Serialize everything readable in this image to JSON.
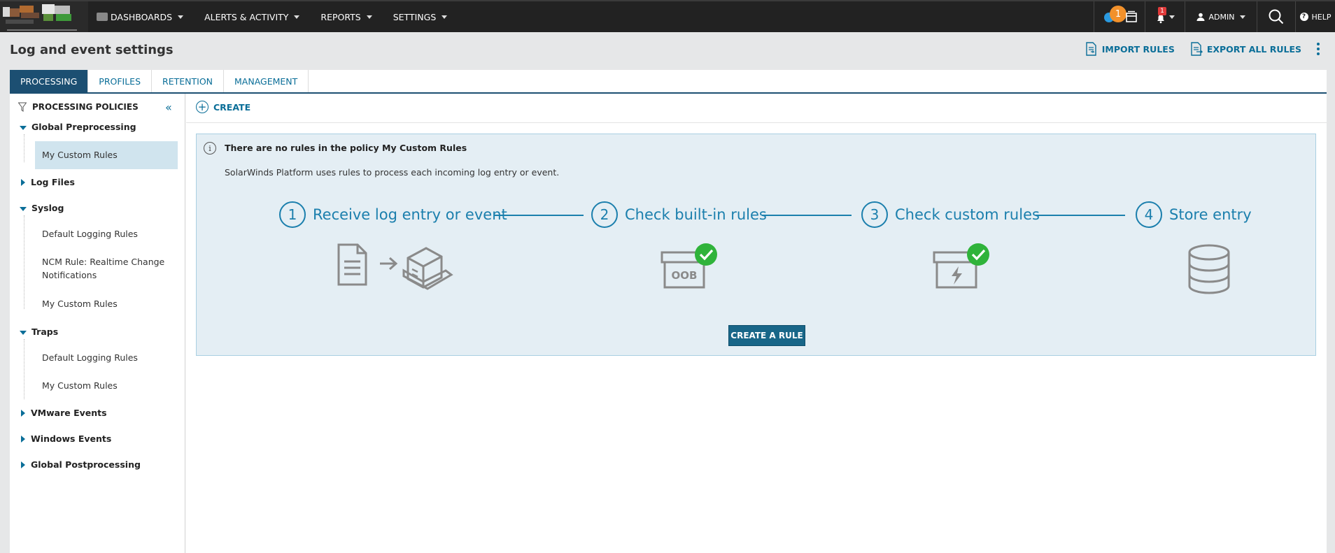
{
  "nav": {
    "items": [
      {
        "label": "DASHBOARDS"
      },
      {
        "label": "ALERTS & ACTIVITY"
      },
      {
        "label": "REPORTS"
      },
      {
        "label": "SETTINGS"
      }
    ],
    "notification_count": "1",
    "alert_count": "1",
    "user_label": "ADMIN",
    "help_label": "HELP",
    "help_glyph": "?"
  },
  "page": {
    "title": "Log and event settings",
    "import_label": "IMPORT RULES",
    "export_label": "EXPORT ALL RULES"
  },
  "tabs": [
    {
      "label": "PROCESSING",
      "active": true
    },
    {
      "label": "PROFILES"
    },
    {
      "label": "RETENTION"
    },
    {
      "label": "MANAGEMENT"
    }
  ],
  "sidebar": {
    "title": "PROCESSING POLICIES",
    "collapse_glyph": "«",
    "groups": [
      {
        "label": "Global Preprocessing",
        "expanded": true,
        "children": [
          "My Custom Rules"
        ]
      },
      {
        "label": "Log Files",
        "expanded": false
      },
      {
        "label": "Syslog",
        "expanded": true,
        "children": [
          "Default Logging Rules",
          "NCM Rule: Realtime Change Notifications",
          "My Custom Rules"
        ]
      },
      {
        "label": "Traps",
        "expanded": true,
        "children": [
          "Default Logging Rules",
          "My Custom Rules"
        ]
      },
      {
        "label": "VMware Events",
        "expanded": false
      },
      {
        "label": "Windows Events",
        "expanded": false
      },
      {
        "label": "Global Postprocessing",
        "expanded": false
      }
    ],
    "selected": "My Custom Rules"
  },
  "toolbar": {
    "create_label": "CREATE",
    "create_glyph": "+"
  },
  "info": {
    "icon_glyph": "i",
    "title": "There are no rules in the policy My Custom Rules",
    "description": "SolarWinds Platform uses rules to process each incoming log entry or event.",
    "steps": [
      {
        "num": "1",
        "label": "Receive log entry or event"
      },
      {
        "num": "2",
        "label": "Check built-in rules"
      },
      {
        "num": "3",
        "label": "Check custom rules"
      },
      {
        "num": "4",
        "label": "Store entry"
      }
    ],
    "oob_text": "OOB",
    "create_rule_label": "CREATE A RULE"
  },
  "colors": {
    "accent": "#0a6e98",
    "step_blue": "#1b7fad",
    "active_tab": "#1c4f72",
    "check_green": "#2fb33a",
    "badge_orange": "#f2912b",
    "badge_red": "#e03a3a"
  }
}
